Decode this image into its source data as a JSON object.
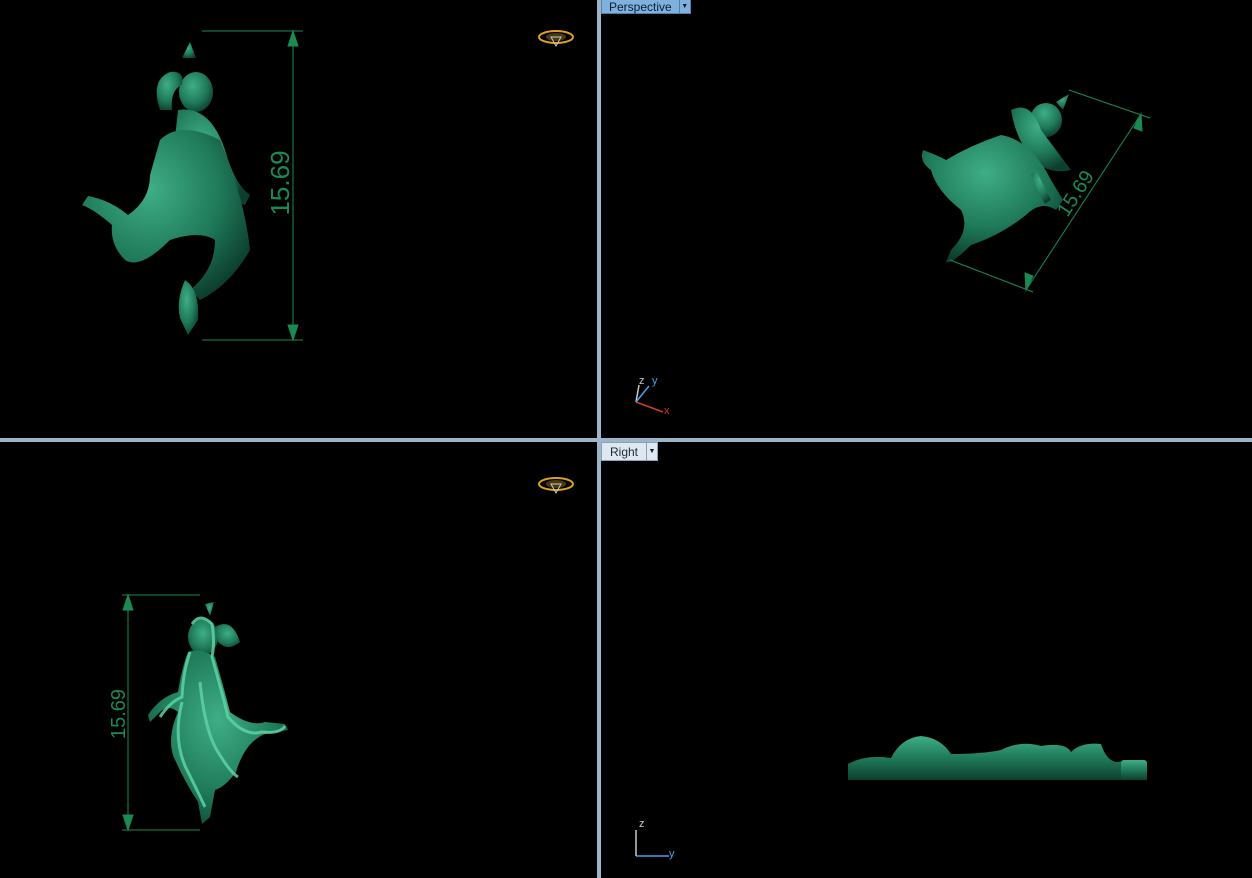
{
  "viewports": {
    "top_left": {
      "dimension": "15.69"
    },
    "top_right": {
      "name": "Perspective",
      "dimension": "15.69",
      "axes": {
        "x": "x",
        "y": "y",
        "z": "z"
      }
    },
    "bottom_left": {
      "dimension": "15.69"
    },
    "bottom_right": {
      "name": "Right",
      "axes": {
        "y": "y",
        "z": "z"
      }
    }
  },
  "colors": {
    "model": "#1f7a5a",
    "model_highlight": "#5fd3a5",
    "dimension": "#1a8a55",
    "splitter": "#9db5c9",
    "active_tab": "#7fb0de",
    "axis_x": "#d23a2a",
    "axis_y": "#4aa0e6",
    "axis_z": "#c9c9c9"
  },
  "icons": [
    "viewport-menu-dropdown-icon",
    "gumball-ring-icon",
    "axis-triad-icon"
  ]
}
